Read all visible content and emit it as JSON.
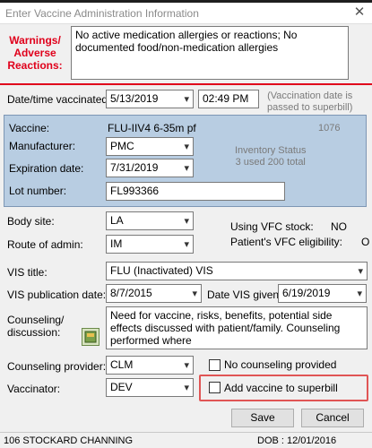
{
  "window": {
    "title": "Enter Vaccine Administration Information",
    "close": "✕"
  },
  "warnings": {
    "label_line1": "Warnings/",
    "label_line2": "Adverse",
    "label_line3": "Reactions:",
    "text": "No active medication allergies or reactions; No documented food/non-medication allergies"
  },
  "datetime": {
    "label": "Date/time vaccinated:",
    "date": "5/13/2019",
    "time": "02:49 PM",
    "note_line1": "(Vaccination date is",
    "note_line2": "passed to superbill)"
  },
  "vaccine": {
    "label": "Vaccine:",
    "value": "FLU-IIV4 6-35m pf",
    "code": "1076",
    "manufacturer_label": "Manufacturer:",
    "manufacturer": "PMC",
    "inventory_line1": "Inventory Status",
    "inventory_line2": "3 used 200 total",
    "expiration_label": "Expiration date:",
    "expiration": "7/31/2019",
    "lot_label": "Lot number:",
    "lot": "FL993366"
  },
  "site": {
    "label": "Body site:",
    "value": "LA",
    "vfc_label": "Using VFC stock:",
    "vfc_value": "NO"
  },
  "route": {
    "label": "Route of admin:",
    "value": "IM",
    "elig_label": "Patient's VFC eligibility:",
    "elig_value": "O"
  },
  "vis": {
    "title_label": "VIS title:",
    "title": "FLU (Inactivated) VIS",
    "pub_label": "VIS publication date:",
    "pub_date": "8/7/2015",
    "given_label": "Date VIS given:",
    "given_date": "6/19/2019"
  },
  "counseling": {
    "label_line1": "Counseling/",
    "label_line2": "discussion:",
    "text": "Need for vaccine, risks, benefits, potential side effects discussed with patient/family. Counseling performed where",
    "provider_label": "Counseling provider:",
    "provider": "CLM",
    "no_counsel_label": "No counseling provided"
  },
  "vaccinator": {
    "label": "Vaccinator:",
    "value": "DEV",
    "superbill_label": "Add vaccine to superbill"
  },
  "buttons": {
    "save": "Save",
    "cancel": "Cancel"
  },
  "status": {
    "patient": "106 STOCKARD CHANNING",
    "dob": "DOB : 12/01/2016"
  },
  "colors": {
    "warning": "#e0001b",
    "vaccine_panel": "#b8cde2",
    "highlight": "#e05555"
  }
}
